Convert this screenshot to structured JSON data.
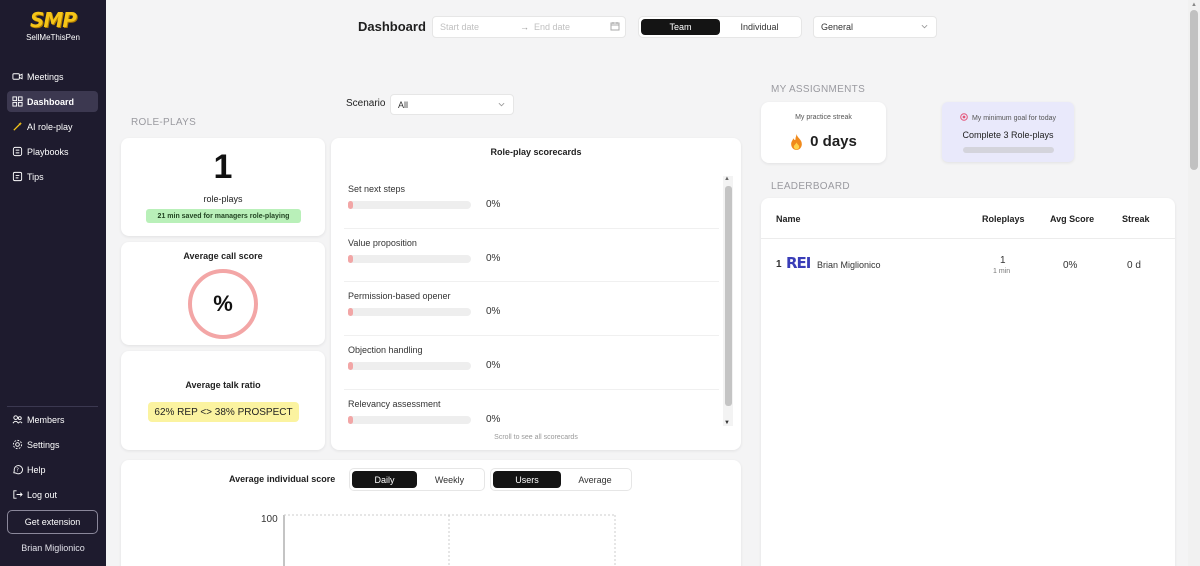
{
  "brand": {
    "logo_text": "SMP",
    "name": "SellMeThisPen"
  },
  "sidebar": {
    "items": [
      {
        "label": "Meetings",
        "icon": "video-icon"
      },
      {
        "label": "Dashboard",
        "icon": "grid-icon",
        "active": true
      },
      {
        "label": "AI role-play",
        "icon": "wand-icon"
      },
      {
        "label": "Playbooks",
        "icon": "book-icon"
      },
      {
        "label": "Tips",
        "icon": "doc-icon"
      }
    ],
    "bottom_items": [
      {
        "label": "Members",
        "icon": "users-icon"
      },
      {
        "label": "Settings",
        "icon": "gear-icon"
      },
      {
        "label": "Help",
        "icon": "help-icon"
      },
      {
        "label": "Log out",
        "icon": "logout-icon"
      }
    ],
    "extension_button": "Get extension",
    "user_name": "Brian Miglionico"
  },
  "header": {
    "title": "Dashboard",
    "start_date_placeholder": "Start date",
    "end_date_placeholder": "End date",
    "arrow": "→",
    "view_toggle": [
      "Team",
      "Individual"
    ],
    "view_selected": "Team",
    "group_select": "General"
  },
  "scenario": {
    "label": "Scenario",
    "value": "All"
  },
  "roleplays": {
    "section_title": "ROLE-PLAYS",
    "count": "1",
    "count_label": "role-plays",
    "saved_badge": "21 min saved for managers role-playing",
    "avg_call_score_title": "Average call score",
    "avg_call_score_value": "%",
    "avg_talk_ratio_title": "Average talk ratio",
    "avg_talk_ratio_value": "62% REP <> 38% PROSPECT"
  },
  "scorecards": {
    "title": "Role-play scorecards",
    "items": [
      {
        "label": "Set next steps",
        "value": "0%"
      },
      {
        "label": "Value proposition",
        "value": "0%"
      },
      {
        "label": "Permission-based opener",
        "value": "0%"
      },
      {
        "label": "Objection handling",
        "value": "0%"
      },
      {
        "label": "Relevancy assessment",
        "value": "0%"
      }
    ],
    "hint": "Scroll to see all scorecards"
  },
  "individual_score": {
    "title": "Average individual score",
    "period_toggle": [
      "Daily",
      "Weekly"
    ],
    "period_selected": "Daily",
    "mode_toggle": [
      "Users",
      "Average"
    ],
    "mode_selected": "Users",
    "y_tick": "100"
  },
  "assignments": {
    "section_title": "MY ASSIGNMENTS",
    "streak_label": "My practice streak",
    "streak_value": "0 days",
    "goal_label": "My minimum goal for today",
    "goal_text": "Complete 3 Role-plays",
    "goal_progress": 0
  },
  "leaderboard": {
    "section_title": "LEADERBOARD",
    "columns": [
      "Name",
      "Roleplays",
      "Avg Score",
      "Streak"
    ],
    "rows": [
      {
        "rank": "1",
        "avatar_text": "REI",
        "name": "Brian Miglionico",
        "roleplays": "1",
        "duration": "1 min",
        "avg_score": "0%",
        "streak": "0 d"
      }
    ]
  },
  "colors": {
    "sidebar_bg": "#1e1b2e",
    "accent_dark": "#141414",
    "score_ring": "#f3a6a6",
    "badge_green": "#b9f0b9",
    "badge_yellow": "#fbf3a0"
  }
}
